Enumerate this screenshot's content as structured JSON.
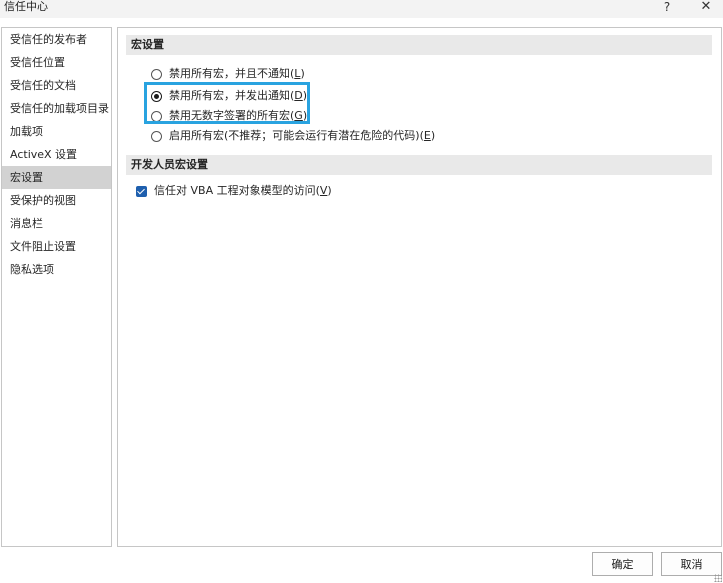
{
  "window": {
    "title": "信任中心",
    "help_label": "?",
    "close_label": "✕"
  },
  "sidebar": {
    "items": [
      {
        "label": "受信任的发布者",
        "selected": false
      },
      {
        "label": "受信任位置",
        "selected": false
      },
      {
        "label": "受信任的文档",
        "selected": false
      },
      {
        "label": "受信任的加载项目录",
        "selected": false
      },
      {
        "label": "加载项",
        "selected": false
      },
      {
        "label": "ActiveX 设置",
        "selected": false
      },
      {
        "label": "宏设置",
        "selected": true
      },
      {
        "label": "受保护的视图",
        "selected": false
      },
      {
        "label": "消息栏",
        "selected": false
      },
      {
        "label": "文件阻止设置",
        "selected": false
      },
      {
        "label": "隐私选项",
        "selected": false
      }
    ]
  },
  "macro_settings": {
    "header": "宏设置",
    "options": [
      {
        "text": "禁用所有宏，并且不通知(",
        "key": "L",
        "suffix": ")",
        "checked": false
      },
      {
        "text": "禁用所有宏，并发出通知(",
        "key": "D",
        "suffix": ")",
        "checked": true
      },
      {
        "text": "禁用无数字签署的所有宏(",
        "key": "G",
        "suffix": ")",
        "checked": false
      },
      {
        "text": "启用所有宏(不推荐；可能会运行有潜在危险的代码)(",
        "key": "E",
        "suffix": ")",
        "checked": false
      }
    ]
  },
  "developer_settings": {
    "header": "开发人员宏设置",
    "trust_vba": {
      "text": "信任对 VBA 工程对象模型的访问(",
      "key": "V",
      "suffix": ")",
      "checked": true
    }
  },
  "footer": {
    "ok_label": "确定",
    "cancel_label": "取消"
  },
  "colors": {
    "highlight": "#29a3e0",
    "checkbox": "#1e5fae",
    "selected_nav": "#d2d2d2"
  }
}
